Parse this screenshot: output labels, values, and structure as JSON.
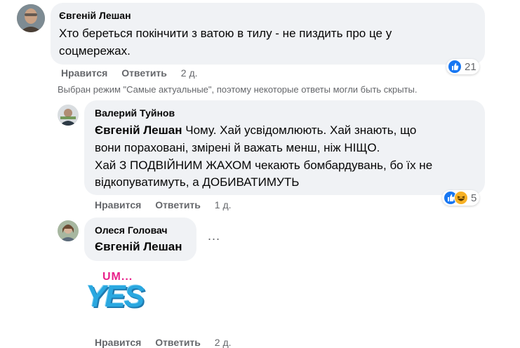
{
  "comments": [
    {
      "author": "Євгеній Лешан",
      "line1": "Хто береться покінчити з ватою в тилу - не пиздить про це у",
      "line2": "соцмережах.",
      "like_label": "Нравится",
      "reply_label": "Ответить",
      "time": "2 д.",
      "reaction_count": "21"
    },
    {
      "author": "Валерий Туйнов",
      "mention": "Євгеній Лешан",
      "line1_rest": " Чому. Хай усвідомлюють. Хай знають, що",
      "line2": "вони пораховані, змірені й важать менш, ніж НІЩО.",
      "line3": "Хай З ПОДВІЙНИМ ЖАХОМ чекають бомбардувань, бо їх не",
      "line4": "відкопуватимуть, а ДОБИВАТИМУТЬ",
      "like_label": "Нравится",
      "reply_label": "Ответить",
      "time": "1 д.",
      "reaction_count": "5"
    },
    {
      "author": "Олеся Головач",
      "mention": "Євгеній Лешан",
      "sticker_top": "UM...",
      "sticker_main": "YES",
      "like_label": "Нравится",
      "reply_label": "Ответить",
      "time": "2 д."
    }
  ],
  "notice": "Выбран режим \"Самые актуальные\", поэтому некоторые ответы могли быть скрыты.",
  "more_options": "...",
  "icons": {
    "like": "like-icon",
    "haha": "haha-icon",
    "more": "more-options-icon"
  },
  "colors": {
    "bubble": "#f0f2f5",
    "meta": "#65676b",
    "like_blue": "#1877f2",
    "sticker_pink": "#e8208a",
    "sticker_blue": "#2aa8e0"
  }
}
